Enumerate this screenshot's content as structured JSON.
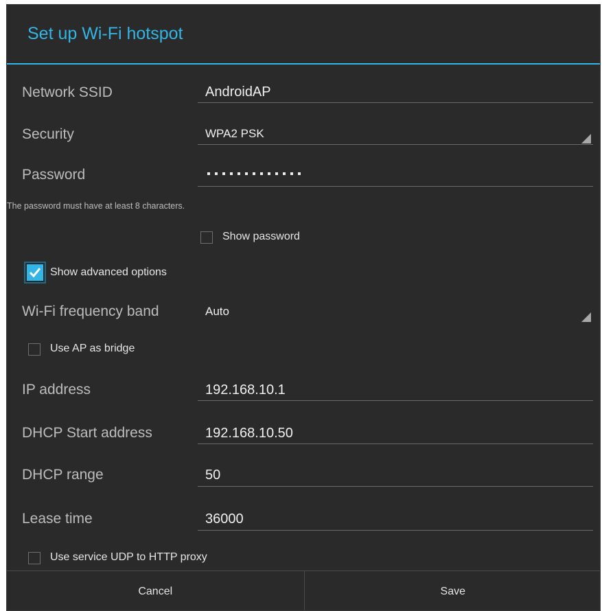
{
  "dialog": {
    "title": "Set up Wi-Fi hotspot",
    "accent_color": "#33b5e5"
  },
  "fields": {
    "ssid": {
      "label": "Network SSID",
      "value": "AndroidAP"
    },
    "security": {
      "label": "Security",
      "value": "WPA2 PSK"
    },
    "password": {
      "label": "Password",
      "masked_chars": 13,
      "helper": "The password must have at least 8 characters."
    },
    "frequency_band": {
      "label": "Wi-Fi frequency band",
      "value": "Auto"
    },
    "ip_address": {
      "label": "IP address",
      "value": "192.168.10.1"
    },
    "dhcp_start": {
      "label": "DHCP Start address",
      "value": "192.168.10.50"
    },
    "dhcp_range": {
      "label": "DHCP range",
      "value": "50"
    },
    "lease_time": {
      "label": "Lease time",
      "value": "36000"
    }
  },
  "checkboxes": {
    "show_password": {
      "label": "Show password",
      "checked": false
    },
    "show_advanced": {
      "label": "Show advanced options",
      "checked": true
    },
    "ap_bridge": {
      "label": "Use AP as bridge",
      "checked": false
    },
    "udp_proxy": {
      "label": "Use service UDP to HTTP proxy",
      "checked": false
    }
  },
  "buttons": {
    "cancel": "Cancel",
    "save": "Save"
  }
}
